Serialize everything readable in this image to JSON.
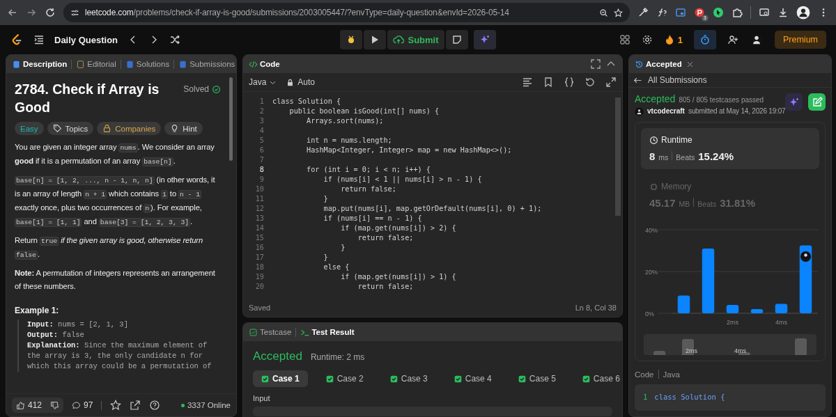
{
  "browser": {
    "url_host": "leetcode.com",
    "url_path": "/problems/check-if-array-is-good/submissions/2003005447/?envType=daily-question&envId=2026-05-14",
    "extension_badge": "3"
  },
  "toolbar": {
    "title": "Daily Question",
    "submit": "Submit",
    "streak": "1",
    "premium": "Premium"
  },
  "description": {
    "tabs": [
      {
        "label": "Description",
        "selected": true
      },
      {
        "label": "Editorial",
        "selected": false
      },
      {
        "label": "Solutions",
        "selected": false
      },
      {
        "label": "Submissions",
        "selected": false
      }
    ],
    "title": "2784. Check if Array is Good",
    "status": "Solved",
    "tags": [
      {
        "label": "Easy",
        "kind": "difficulty"
      },
      {
        "label": "Topics",
        "kind": "topics"
      },
      {
        "label": "Companies",
        "kind": "companies"
      },
      {
        "label": "Hint",
        "kind": "hint"
      }
    ],
    "paragraphs": [
      [
        {
          "kind": "text",
          "text": "You are given an integer array "
        },
        {
          "kind": "code",
          "text": "nums"
        },
        {
          "kind": "text",
          "text": ". We consider an array **good** if it is a permutation of an array "
        },
        {
          "kind": "code",
          "text": "base[n]"
        },
        {
          "kind": "text",
          "text": "."
        }
      ],
      [
        {
          "kind": "code",
          "text": "base[n] = [1, 2, ..., n - 1, n, n]"
        },
        {
          "kind": "text",
          "text": " (in other words, it is an array of length "
        },
        {
          "kind": "code",
          "text": "n + 1"
        },
        {
          "kind": "text",
          "text": " which contains "
        },
        {
          "kind": "code",
          "text": "1"
        },
        {
          "kind": "text",
          "text": " to "
        },
        {
          "kind": "code",
          "text": "n - 1"
        },
        {
          "kind": "text",
          "text": " exactly once, plus two occurrences of "
        },
        {
          "kind": "code",
          "text": "n"
        },
        {
          "kind": "text",
          "text": "). For example, "
        },
        {
          "kind": "code",
          "text": "base[1] = [1, 1]"
        },
        {
          "kind": "text",
          "text": " and "
        },
        {
          "kind": "code",
          "text": "base[3] = [1, 2, 3, 3]"
        },
        {
          "kind": "text",
          "text": "."
        }
      ],
      [
        {
          "kind": "text",
          "text": "Return "
        },
        {
          "kind": "code",
          "text": "true"
        },
        {
          "kind": "text",
          "text": " *if the given array is good, otherwise return* "
        },
        {
          "kind": "code",
          "text": "false"
        },
        {
          "kind": "text",
          "text": "."
        }
      ],
      [
        {
          "kind": "text",
          "text": "**Note:** A permutation of integers represents an arrangement of these numbers."
        }
      ]
    ],
    "example": {
      "title": "Example 1:",
      "lines": [
        {
          "label": "Input:",
          "text": "nums = [2, 1, 3]"
        },
        {
          "label": "Output:",
          "text": "false"
        },
        {
          "label": "Explanation:",
          "text": "Since the maximum element of the array is 3, the only candidate n for which this array could be a permutation of"
        }
      ]
    },
    "footer": {
      "likes": "412",
      "comments": "97",
      "online": "3337 Online"
    }
  },
  "editor": {
    "title": "Code",
    "language": "Java",
    "mode": "Auto",
    "status": "Saved",
    "cursor": "Ln 8, Col 38",
    "lines": [
      {
        "number": "1",
        "text": "class Solution {",
        "current": false
      },
      {
        "number": "2",
        "text": "    public boolean isGood(int[] nums) {",
        "current": false
      },
      {
        "number": "3",
        "text": "        Arrays.sort(nums);",
        "current": false
      },
      {
        "number": "4",
        "current": false
      },
      {
        "number": "5",
        "text": "        int n = nums.length;",
        "current": false
      },
      {
        "number": "6",
        "text": "        HashMap<Integer, Integer> map = new HashMap<>();",
        "current": false
      },
      {
        "number": "7",
        "current": false
      },
      {
        "number": "8",
        "text": "        for (int i = 0; i < n; i++) {",
        "current": true
      },
      {
        "number": "9",
        "text": "            if (nums[i] < 1 || nums[i] > n - 1) {",
        "current": false
      },
      {
        "number": "10",
        "text": "                return false;",
        "current": false
      },
      {
        "number": "11",
        "text": "            }",
        "current": false
      },
      {
        "number": "12",
        "text": "            map.put(nums[i], map.getOrDefault(nums[i], 0) + 1);",
        "current": false
      },
      {
        "number": "13",
        "text": "            if (nums[i] == n - 1) {",
        "current": false
      },
      {
        "number": "14",
        "text": "                if (map.get(nums[i]) > 2) {",
        "current": false
      },
      {
        "number": "15",
        "text": "                    return false;",
        "current": false
      },
      {
        "number": "16",
        "text": "                }",
        "current": false
      },
      {
        "number": "17",
        "text": "            }",
        "current": false
      },
      {
        "number": "18",
        "text": "            else {",
        "current": false
      },
      {
        "number": "19",
        "text": "                if (map.get(nums[i]) > 1) {",
        "current": false
      },
      {
        "number": "20",
        "text": "                    return false;",
        "current": false
      }
    ]
  },
  "results": {
    "tabs": [
      {
        "label": "Testcase",
        "selected": false
      },
      {
        "label": "Test Result",
        "selected": true
      }
    ],
    "status": "Accepted",
    "runtime": "Runtime: 2 ms",
    "cases": [
      {
        "label": "Case 1",
        "passed": true,
        "selected": true
      },
      {
        "label": "Case 2",
        "passed": true,
        "selected": false
      },
      {
        "label": "Case 3",
        "passed": true,
        "selected": false
      },
      {
        "label": "Case 4",
        "passed": true,
        "selected": false
      },
      {
        "label": "Case 5",
        "passed": true,
        "selected": false
      },
      {
        "label": "Case 6",
        "passed": true,
        "selected": false
      }
    ],
    "input_label": "Input"
  },
  "submission": {
    "tab": "Accepted",
    "back": "All Submissions",
    "status": "Accepted",
    "passed": "805 / 805 testcases passed",
    "user": "vtcodecraft",
    "submitted": "submitted at May 14, 2026 19:07",
    "metrics": [
      {
        "label": "Runtime",
        "value": "8",
        "unit": "ms",
        "beats_label": "Beats",
        "beats": "15.24%",
        "selected": true
      },
      {
        "label": "Memory",
        "value": "45.17",
        "unit": "MB",
        "beats_label": "Beats",
        "beats": "31.81%",
        "selected": false
      }
    ],
    "chart_data": {
      "type": "bar",
      "categories": [
        null,
        null,
        "2ms",
        null,
        "4ms",
        null
      ],
      "values": [
        8.5,
        31,
        4,
        2,
        4.5,
        32.5
      ],
      "ylim": [
        0,
        40
      ],
      "yticks": [
        {
          "value": 0,
          "label": "0%"
        },
        {
          "value": 20,
          "label": "20%"
        },
        {
          "value": 40,
          "label": "40%"
        }
      ]
    },
    "navigator_labels": [
      "2ms",
      "4ms"
    ],
    "code_label": "Code",
    "language": "Java",
    "code_preview": [
      {
        "number": "1",
        "text": "class Solution {"
      }
    ]
  }
}
